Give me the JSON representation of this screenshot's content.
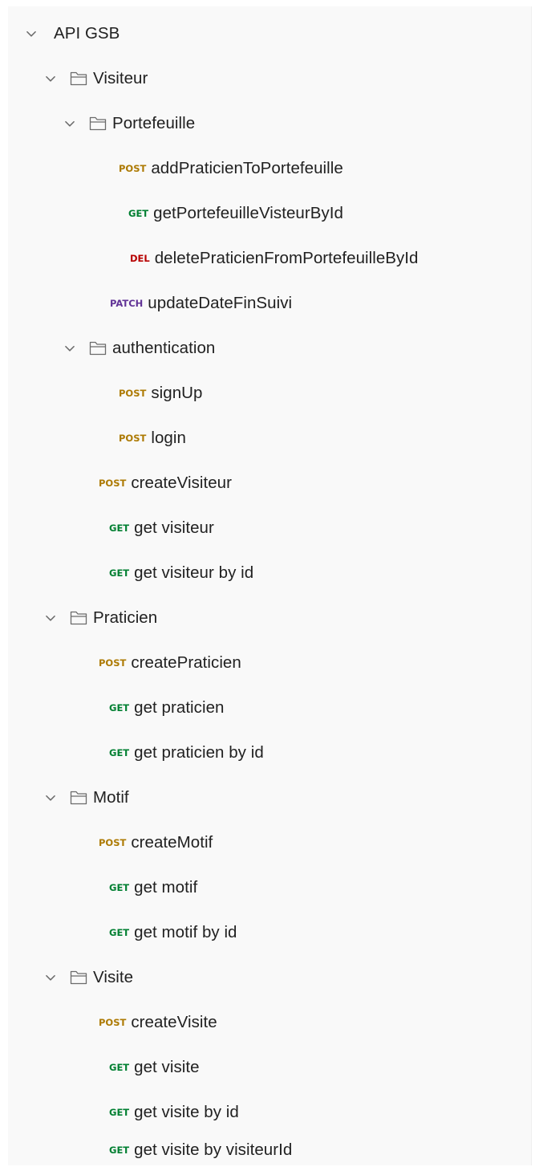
{
  "collection": {
    "name": "API GSB",
    "colors": {
      "POST": "#ad7a03",
      "GET": "#007f31",
      "DEL": "#b70000",
      "PATCH": "#623497",
      "text": "#212121",
      "icon": "#6b6b6b"
    },
    "tree": [
      {
        "type": "root",
        "label": "API GSB",
        "expanded": true,
        "icon": "chevron-down-icon"
      },
      {
        "type": "folder",
        "label": "Visiteur",
        "expanded": true,
        "icon": "folder-icon"
      },
      {
        "type": "folder",
        "label": "Portefeuille",
        "expanded": true,
        "icon": "folder-icon"
      },
      {
        "type": "request",
        "method": "POST",
        "label": "addPraticienToPortefeuille"
      },
      {
        "type": "request",
        "method": "GET",
        "label": "getPortefeuilleVisteurById"
      },
      {
        "type": "request",
        "method": "DEL",
        "label": "deletePraticienFromPortefeuilleById"
      },
      {
        "type": "request",
        "method": "PATCH",
        "label": "updateDateFinSuivi"
      },
      {
        "type": "folder",
        "label": "authentication",
        "expanded": true,
        "icon": "folder-icon"
      },
      {
        "type": "request",
        "method": "POST",
        "label": "signUp"
      },
      {
        "type": "request",
        "method": "POST",
        "label": "login"
      },
      {
        "type": "request",
        "method": "POST",
        "label": "createVisiteur"
      },
      {
        "type": "request",
        "method": "GET",
        "label": "get visiteur"
      },
      {
        "type": "request",
        "method": "GET",
        "label": "get visiteur by id"
      },
      {
        "type": "folder",
        "label": "Praticien",
        "expanded": true,
        "icon": "folder-icon"
      },
      {
        "type": "request",
        "method": "POST",
        "label": "createPraticien"
      },
      {
        "type": "request",
        "method": "GET",
        "label": "get praticien"
      },
      {
        "type": "request",
        "method": "GET",
        "label": "get praticien by id"
      },
      {
        "type": "folder",
        "label": "Motif",
        "expanded": true,
        "icon": "folder-icon"
      },
      {
        "type": "request",
        "method": "POST",
        "label": "createMotif"
      },
      {
        "type": "request",
        "method": "GET",
        "label": "get motif"
      },
      {
        "type": "request",
        "method": "GET",
        "label": "get motif by id"
      },
      {
        "type": "folder",
        "label": "Visite",
        "expanded": true,
        "icon": "folder-icon"
      },
      {
        "type": "request",
        "method": "POST",
        "label": "createVisite"
      },
      {
        "type": "request",
        "method": "GET",
        "label": "get visite"
      },
      {
        "type": "request",
        "method": "GET",
        "label": "get visite by id"
      },
      {
        "type": "request",
        "method": "GET",
        "label": "get visite by visiteurId"
      }
    ]
  }
}
